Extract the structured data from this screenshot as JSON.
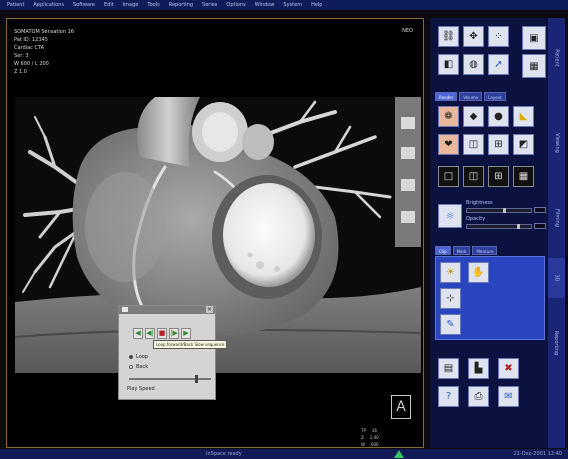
{
  "menu": [
    "Patient",
    "Applications",
    "Software",
    "Edit",
    "Image",
    "Tools",
    "Reporting",
    "Series",
    "Options",
    "Window",
    "System",
    "Help"
  ],
  "viewer": {
    "header_lines": [
      "SOMATOM Sensation 16",
      "Pat ID: 12345",
      "Cardiac CTA",
      "Ser: 3",
      "W 600 / L 200",
      "Z 1.0"
    ],
    "top_right": "NEO",
    "orientation_label": "A",
    "coords": [
      [
        "TP",
        "16"
      ],
      [
        "Z",
        "1.00"
      ],
      [
        "W",
        "600"
      ],
      [
        "L",
        "200"
      ]
    ]
  },
  "cine": {
    "buttons": [
      "◀",
      "◀|",
      "■",
      "|▶",
      "▶"
    ],
    "tooltip": "Loop forward/Back Slow sequence",
    "options": [
      {
        "label": "Loop",
        "selected": true
      },
      {
        "label": "Back",
        "selected": false
      }
    ],
    "speed_label": "Play Speed",
    "speed_value": 0.82
  },
  "panel": {
    "tool_group_1": [
      "link-icon",
      "move-icon",
      "dots-icon",
      "image-icon",
      "cube-icon",
      "sphere-icon",
      "pointer-icon",
      "grid-icon"
    ],
    "render_tabs": [
      "Render",
      "Volume",
      "Layout"
    ],
    "render_tools": [
      "vrt-icon",
      "cube-icon",
      "sphere-icon",
      "bone-icon",
      "heart-icon",
      "frame-icon",
      "grid-icon",
      "cube2-icon"
    ],
    "layout_tools": [
      "layout-1x1-icon",
      "layout-1x2-icon",
      "layout-2x2-icon",
      "layout-3d-icon"
    ],
    "brightness_label": "Brightness",
    "brightness_value": 0.58,
    "opacity_label": "Opacity",
    "opacity_value": 0.79,
    "edit_tabs": [
      "Clip",
      "Mark",
      "Measure"
    ],
    "edit_tools": [
      "lamp-icon",
      "hand-icon",
      "clip-icon",
      "pen-icon"
    ],
    "bottom_tools": [
      "calc-icon",
      "sort-icon",
      "delete-icon",
      "help-icon",
      "print-icon",
      "note-icon"
    ]
  },
  "side_tabs": [
    "Patient",
    "Viewing",
    "Filming",
    "3D",
    "Reporting"
  ],
  "status": {
    "center": "InSpace ready",
    "right": "21-Dec-2001 13:40"
  }
}
